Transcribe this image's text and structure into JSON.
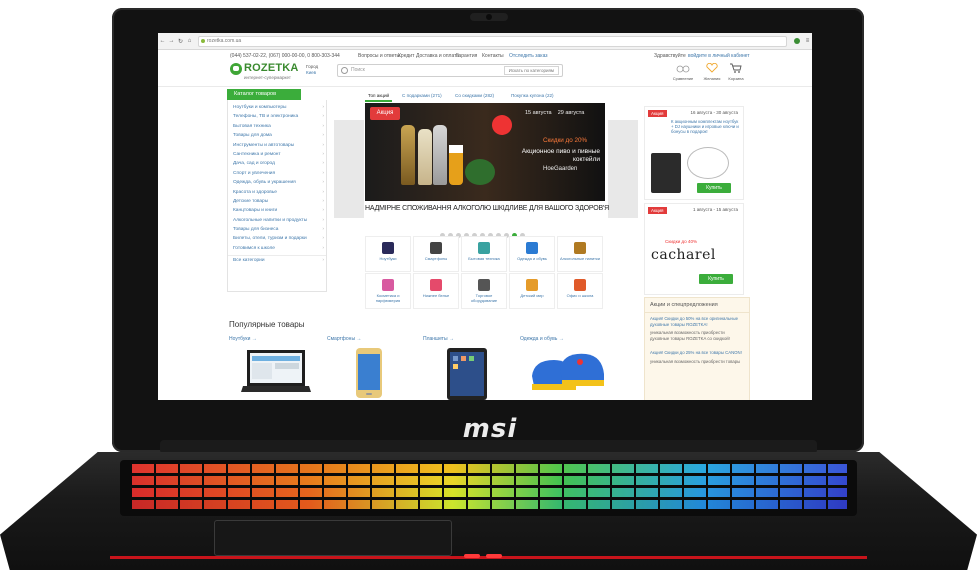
{
  "device": {
    "brand": "msi"
  },
  "browser": {
    "url": "rozetka.com.ua"
  },
  "site": {
    "top_bar": {
      "phones": "(044) 537-02-22, (067) 000-00-00, 0 800-303-344",
      "links": [
        "Вопросы и ответы",
        "Кредит",
        "Доставка и оплата",
        "Гарантия",
        "Контакты"
      ],
      "track_order": "Отследить заказ",
      "greeting": "Здравствуйте",
      "login": "войдите в личный кабинет"
    },
    "header": {
      "logo": "ROZETKA",
      "tagline": "интернет-супермаркет",
      "city_label": "Город",
      "city_value": "Киев",
      "search_placeholder": "Поиск",
      "search_scope": "Искать по категориям",
      "icons": [
        {
          "name": "scales-icon",
          "label": "Сравнение"
        },
        {
          "name": "heart-icon",
          "label": "Желания"
        },
        {
          "name": "cart-icon",
          "label": "Корзина"
        }
      ]
    },
    "catalog": {
      "button": "Каталог товаров",
      "items": [
        "Ноутбуки и компьютеры",
        "Телефоны, ТВ и электроника",
        "Бытовая техника",
        "Товары для дома",
        "Инструменты и автотовары",
        "Сантехника и ремонт",
        "Дача, сад и огород",
        "Спорт и увлечения",
        "Одежда, обувь и украшения",
        "Красота и здоровье",
        "Детские товары",
        "Канцтовары и книги",
        "Алкогольные напитки и продукты",
        "Товары для бизнеса",
        "Билеты, отели, туризм и подарки",
        "Готовимся к школе"
      ],
      "footer": "Все категории"
    },
    "banner_tabs": {
      "tabs": [
        "Топ акций",
        "С подарками (271)",
        "Со скидками (282)",
        "Покупка купона (22)"
      ],
      "active": 0
    },
    "banner": {
      "badge": "Акция",
      "date_from": "15 августа",
      "date_to": "29 августа",
      "discount": "Скидки до 20%",
      "text": "Акционное пиво и пивные коктейли",
      "brand": "HoeGaarden",
      "warning": "НАДМІРНЕ СПОЖИВАННЯ АЛКОГОЛЮ ШКІДЛИВЕ ДЛЯ ВАШОГО ЗДОРОВ'Я",
      "slides": 11,
      "active_slide": 9
    },
    "tiles": [
      {
        "label": "Ноутбуки",
        "color": "#2a2a5a"
      },
      {
        "label": "Смартфоны",
        "color": "#444444"
      },
      {
        "label": "Бытовая техника",
        "color": "#39a2a0"
      },
      {
        "label": "Одежда и обувь",
        "color": "#2b7bd3"
      },
      {
        "label": "Алкогольные напитки",
        "color": "#b07a22"
      },
      {
        "label": "Косметика и парфюмерия",
        "color": "#d85aa0"
      },
      {
        "label": "Нижнее белье",
        "color": "#e54a6b"
      },
      {
        "label": "Торговое оборудование",
        "color": "#555555"
      },
      {
        "label": "Детский мир",
        "color": "#e59b2a"
      },
      {
        "label": "Офис и школа",
        "color": "#e05a2a"
      }
    ],
    "promos": [
      {
        "tag": "Акция",
        "dates": "16 августа - 30 августа",
        "text": "К акционным комплектам ноутбук + DJ наушники и игровые ключи и бонусы в подарок!",
        "button": "Купить"
      },
      {
        "tag": "Акция",
        "dates": "1 августа - 15 августа",
        "discount": "Скидки до 40%",
        "brand": "cacharel",
        "button": "Купить"
      }
    ],
    "promo_list": {
      "title": "Акции и спецпредложения",
      "items": [
        {
          "title": "Акция! Скидки до 50% на все оригинальные духовные товары ROZETKA!",
          "note": "уникальная возможность приобрести духовные товары ROZETKA со скидкой!"
        },
        {
          "title": "Акция! Скидки до 25% на все товары CANON!",
          "note": "уникальная возможность приобрести товары"
        }
      ]
    },
    "popular": {
      "title": "Популярные товары",
      "columns": [
        "Ноутбуки →",
        "Смартфоны →",
        "Планшеты →",
        "Одежда и обувь →"
      ]
    }
  }
}
